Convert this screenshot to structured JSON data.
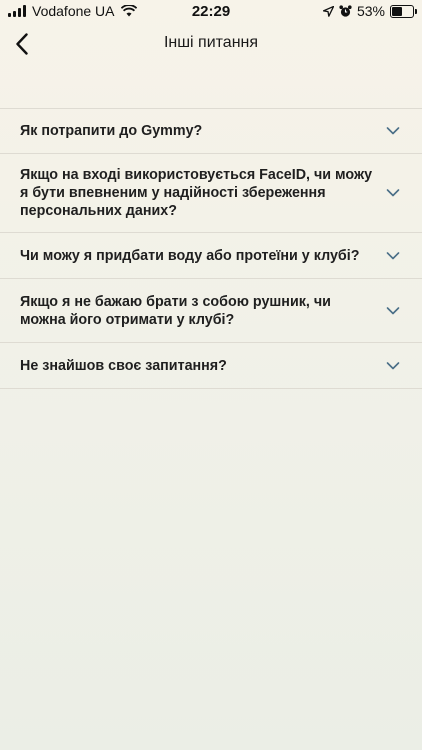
{
  "status_bar": {
    "carrier": "Vodafone UA",
    "time": "22:29",
    "battery_percent": "53%",
    "battery_level": 0.53,
    "icons": [
      "signal-icon",
      "wifi-icon",
      "location-icon",
      "alarm-icon",
      "battery-icon"
    ]
  },
  "nav": {
    "title": "Інші питання",
    "back_icon": "chevron-left-icon"
  },
  "faq": {
    "items": [
      {
        "question": "Як потрапити до Gymmy?"
      },
      {
        "question": "Якщо на вході використовується FaceID, чи можу я бути впевненим у надійності збереження персональних даних?"
      },
      {
        "question": "Чи можу я придбати воду або протеїни у клубі?"
      },
      {
        "question": "Якщо я не бажаю брати з собою рушник, чи можна його отримати у клубі?"
      },
      {
        "question": "Не знайшов своє запитання?"
      }
    ],
    "chevron_color": "#4a6f87"
  }
}
